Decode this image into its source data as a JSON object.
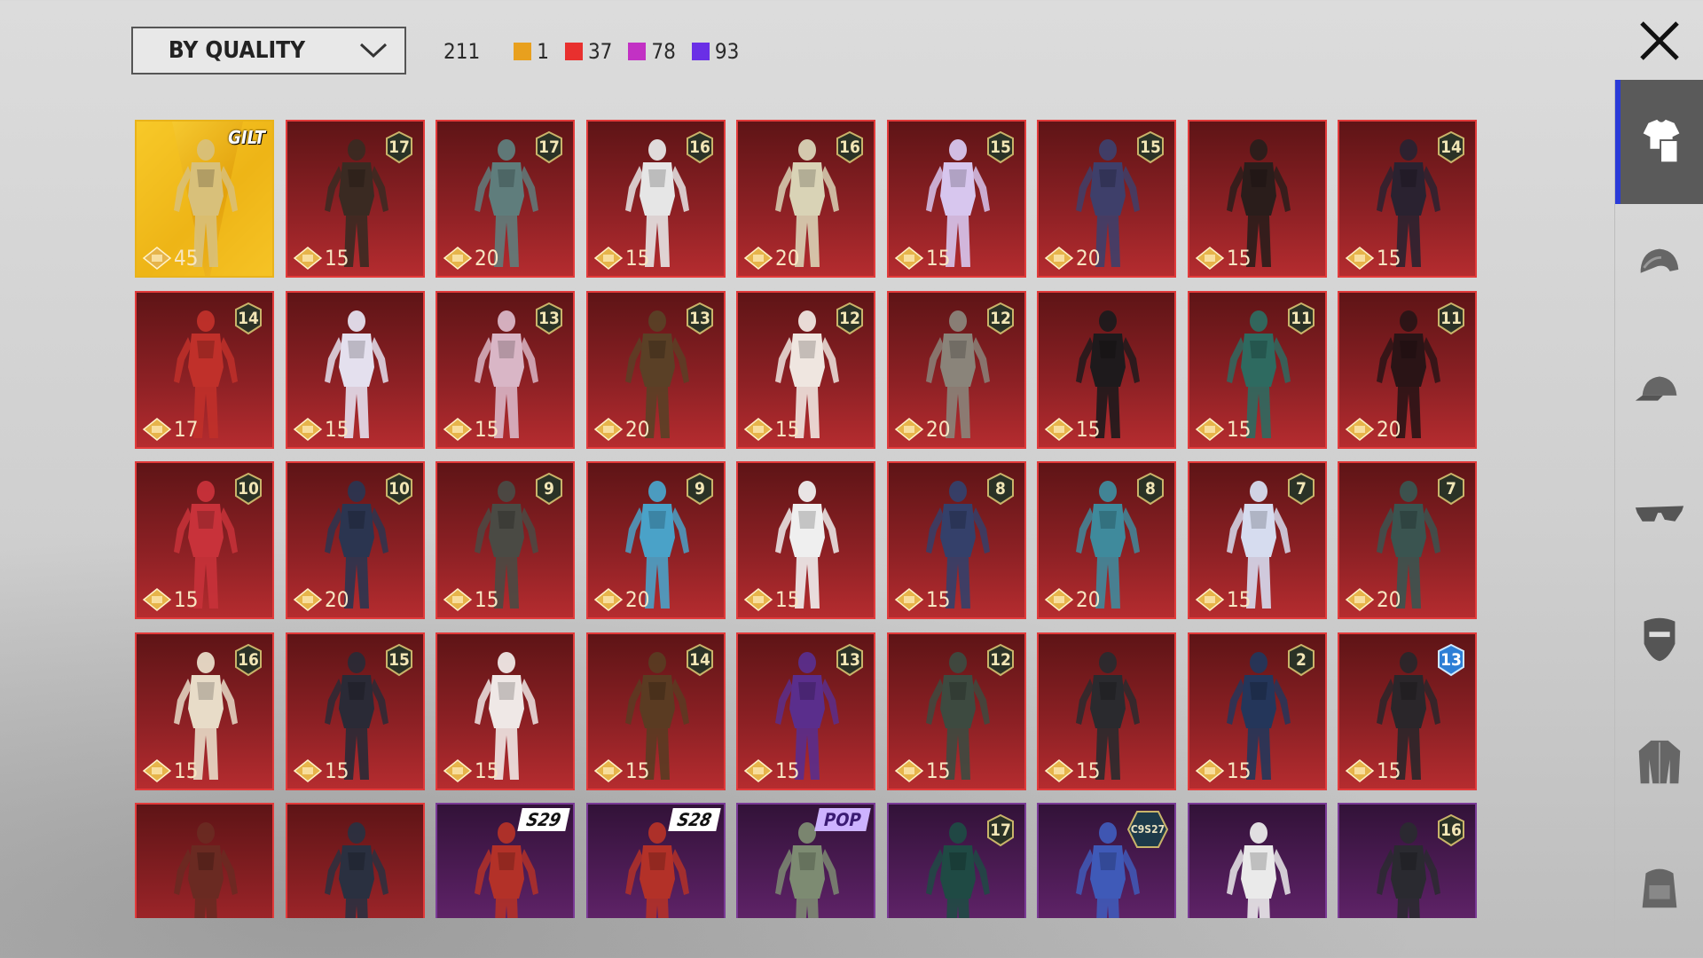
{
  "sort": {
    "label": "BY QUALITY"
  },
  "counts": {
    "total": "211",
    "items": [
      {
        "color": "#e8a01e",
        "value": "1"
      },
      {
        "color": "#e8302e",
        "value": "37"
      },
      {
        "color": "#c231c4",
        "value": "78"
      },
      {
        "color": "#6a2fe6",
        "value": "93"
      }
    ]
  },
  "rail": {
    "tabs": [
      {
        "icon": "outfit-icon",
        "active": true
      },
      {
        "icon": "helmet-icon",
        "active": false
      },
      {
        "icon": "cap-icon",
        "active": false
      },
      {
        "icon": "glasses-icon",
        "active": false
      },
      {
        "icon": "mask-icon",
        "active": false
      },
      {
        "icon": "jacket-icon",
        "active": false
      },
      {
        "icon": "backpack-icon",
        "active": false
      }
    ]
  },
  "items": [
    {
      "theme": "gold",
      "level": "",
      "points": "45",
      "brand": "GILT",
      "tag": "",
      "hue": "#d8c07a"
    },
    {
      "theme": "red",
      "level": "17",
      "points": "15",
      "tag": "",
      "hue": "#3a2a22"
    },
    {
      "theme": "red",
      "level": "17",
      "points": "20",
      "tag": "",
      "hue": "#5f7d7c"
    },
    {
      "theme": "red",
      "level": "16",
      "points": "15",
      "tag": "",
      "hue": "#e6e6e6"
    },
    {
      "theme": "red",
      "level": "16",
      "points": "20",
      "tag": "",
      "hue": "#d9d3b6"
    },
    {
      "theme": "red",
      "level": "15",
      "points": "15",
      "tag": "",
      "hue": "#d7c6ee"
    },
    {
      "theme": "red",
      "level": "15",
      "points": "20",
      "tag": "",
      "hue": "#3e3f6a"
    },
    {
      "theme": "red",
      "level": "",
      "points": "15",
      "tag": "",
      "hue": "#2a1d1b"
    },
    {
      "theme": "red",
      "level": "14",
      "points": "15",
      "tag": "",
      "hue": "#2a2230"
    },
    {
      "theme": "red",
      "level": "14",
      "points": "17",
      "tag": "",
      "hue": "#c0302a"
    },
    {
      "theme": "red",
      "level": "",
      "points": "15",
      "tag": "",
      "hue": "#e4e0ee"
    },
    {
      "theme": "red",
      "level": "13",
      "points": "15",
      "tag": "",
      "hue": "#d9b6c6"
    },
    {
      "theme": "red",
      "level": "13",
      "points": "20",
      "tag": "",
      "hue": "#5a4026"
    },
    {
      "theme": "red",
      "level": "12",
      "points": "15",
      "tag": "",
      "hue": "#efe6e0"
    },
    {
      "theme": "red",
      "level": "12",
      "points": "20",
      "tag": "",
      "hue": "#8a847a"
    },
    {
      "theme": "red",
      "level": "",
      "points": "15",
      "tag": "",
      "hue": "#1e1a1c"
    },
    {
      "theme": "red",
      "level": "11",
      "points": "15",
      "tag": "",
      "hue": "#2e6a60"
    },
    {
      "theme": "red",
      "level": "11",
      "points": "20",
      "tag": "",
      "hue": "#2a1416"
    },
    {
      "theme": "red",
      "level": "10",
      "points": "15",
      "tag": "",
      "hue": "#c8323a"
    },
    {
      "theme": "red",
      "level": "10",
      "points": "20",
      "tag": "",
      "hue": "#2b3550"
    },
    {
      "theme": "red",
      "level": "9",
      "points": "15",
      "tag": "",
      "hue": "#4a4a44"
    },
    {
      "theme": "red",
      "level": "9",
      "points": "20",
      "tag": "",
      "hue": "#4aa2c8"
    },
    {
      "theme": "red",
      "level": "",
      "points": "15",
      "tag": "",
      "hue": "#efefef"
    },
    {
      "theme": "red",
      "level": "8",
      "points": "15",
      "tag": "",
      "hue": "#34406a"
    },
    {
      "theme": "red",
      "level": "8",
      "points": "20",
      "tag": "",
      "hue": "#3f8a9c"
    },
    {
      "theme": "red",
      "level": "7",
      "points": "15",
      "tag": "",
      "hue": "#d6dcef"
    },
    {
      "theme": "red",
      "level": "7",
      "points": "20",
      "tag": "",
      "hue": "#3a5450"
    },
    {
      "theme": "red",
      "level": "16",
      "points": "15",
      "tag": "",
      "hue": "#e8dcc8"
    },
    {
      "theme": "red",
      "level": "15",
      "points": "15",
      "tag": "",
      "hue": "#2a2a36"
    },
    {
      "theme": "red",
      "level": "",
      "points": "15",
      "tag": "",
      "hue": "#efe8e6"
    },
    {
      "theme": "red",
      "level": "14",
      "points": "15",
      "tag": "",
      "hue": "#5a3b22"
    },
    {
      "theme": "red",
      "level": "13",
      "points": "15",
      "tag": "",
      "hue": "#5a2e8c"
    },
    {
      "theme": "red",
      "level": "12",
      "points": "15",
      "tag": "",
      "hue": "#3d4a40"
    },
    {
      "theme": "red",
      "level": "",
      "points": "15",
      "tag": "",
      "hue": "#2a2a2e"
    },
    {
      "theme": "red",
      "level": "2",
      "points": "15",
      "tag": "",
      "hue": "#24365a"
    },
    {
      "theme": "red",
      "level": "13",
      "levelStyle": "blue",
      "points": "15",
      "tag": "",
      "hue": "#2a262a"
    },
    {
      "theme": "red",
      "level": "",
      "points": "",
      "tag": "",
      "hue": "#6a2a22"
    },
    {
      "theme": "red",
      "level": "",
      "points": "",
      "tag": "",
      "hue": "#2a3040"
    },
    {
      "theme": "purple",
      "level": "",
      "points": "",
      "tag": "S29",
      "hue": "#b33128"
    },
    {
      "theme": "purple",
      "level": "",
      "points": "",
      "tag": "S28",
      "hue": "#b33128"
    },
    {
      "theme": "purple",
      "level": "",
      "points": "",
      "tag": "POP",
      "tagStyle": "pop",
      "hue": "#7d8b72"
    },
    {
      "theme": "purple",
      "level": "17",
      "points": "",
      "tag": "",
      "hue": "#1f4a44"
    },
    {
      "theme": "purple",
      "level": "",
      "points": "",
      "tag": "",
      "badge": "C9S27",
      "hue": "#3f5ab8"
    },
    {
      "theme": "purple",
      "level": "",
      "points": "",
      "tag": "",
      "hue": "#eaeaea"
    },
    {
      "theme": "purple",
      "level": "16",
      "points": "",
      "tag": "",
      "hue": "#2a2a30"
    }
  ]
}
